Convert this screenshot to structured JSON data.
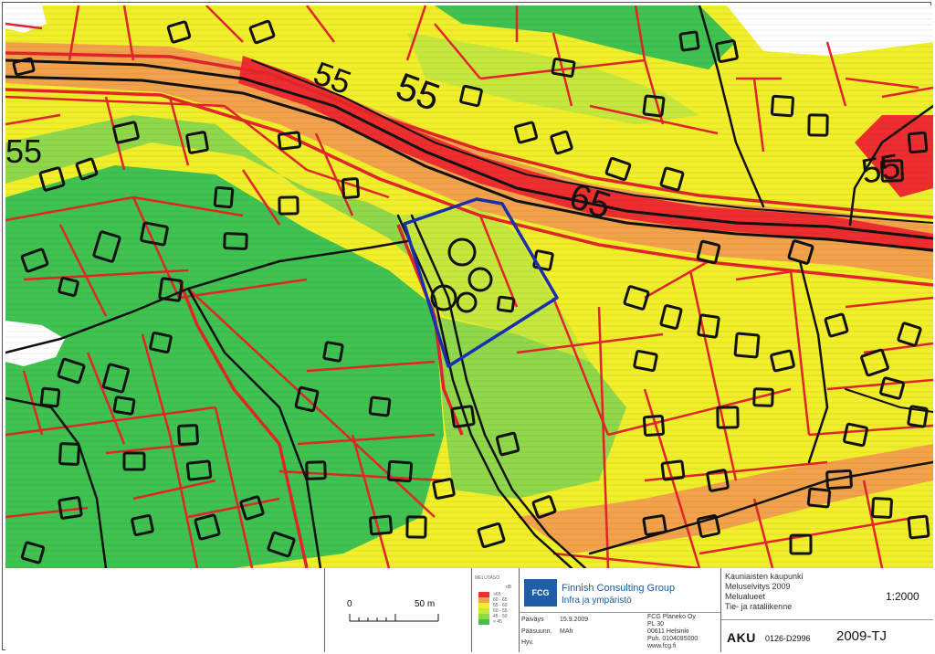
{
  "map": {
    "zone_colors": {
      "over_65": "#ee2e2e",
      "60_65": "#f2a24a",
      "55_60": "#f1ee2a",
      "50_55": "#c6e83c",
      "45_50": "#8fd84a",
      "under_45": "#3fc24f",
      "plot_line": "#e0242a",
      "outline": "#111111",
      "area_boundary": "#1a2fb0"
    },
    "labels": [
      {
        "text": "55",
        "kind": "contour-label"
      },
      {
        "text": "55",
        "kind": "contour-label"
      },
      {
        "text": "55",
        "kind": "contour-label"
      },
      {
        "text": "65",
        "kind": "contour-label"
      },
      {
        "text": "55",
        "kind": "contour-label"
      }
    ]
  },
  "scale_bar": {
    "start_label": "0",
    "end_label": "50 m"
  },
  "legend": {
    "title": "MELUTASO",
    "unit": "dB",
    "rows": [
      {
        "label": ">65",
        "color": "#ee2e2e"
      },
      {
        "label": "60 - 65",
        "color": "#f2a24a"
      },
      {
        "label": "55 - 60",
        "color": "#f1ee2a"
      },
      {
        "label": "50 - 55",
        "color": "#c6e83c"
      },
      {
        "label": "45 - 50",
        "color": "#8fd84a"
      },
      {
        "label": "< 45",
        "color": "#3fc24f"
      }
    ]
  },
  "title_block": {
    "logo_text": "FCG",
    "company_name": "Finnish Consulting Group",
    "company_sub": "Infra ja ympäristö",
    "date_label": "Päiväys",
    "date_value": "15.9.2009",
    "designer_label": "Pääsuunn.",
    "designer_value": "MAh",
    "approved_label": "Hyv.",
    "address_1": "FCG Planeko Oy",
    "address_2": "PL 30",
    "address_3": "00611 Helsinki",
    "address_4": "Puh. 0104095000",
    "address_5": "www.fcg.fi",
    "client": "Kauniaisten kaupunki",
    "project": "Meluselvitys 2009",
    "drawing_title": "Melualueet",
    "drawing_subtitle": "Tie- ja rataliikenne",
    "scale": "1:2000",
    "proj_code": "AKU",
    "drawing_number": "0126-D2996",
    "drawing_code": "2009-TJ"
  }
}
